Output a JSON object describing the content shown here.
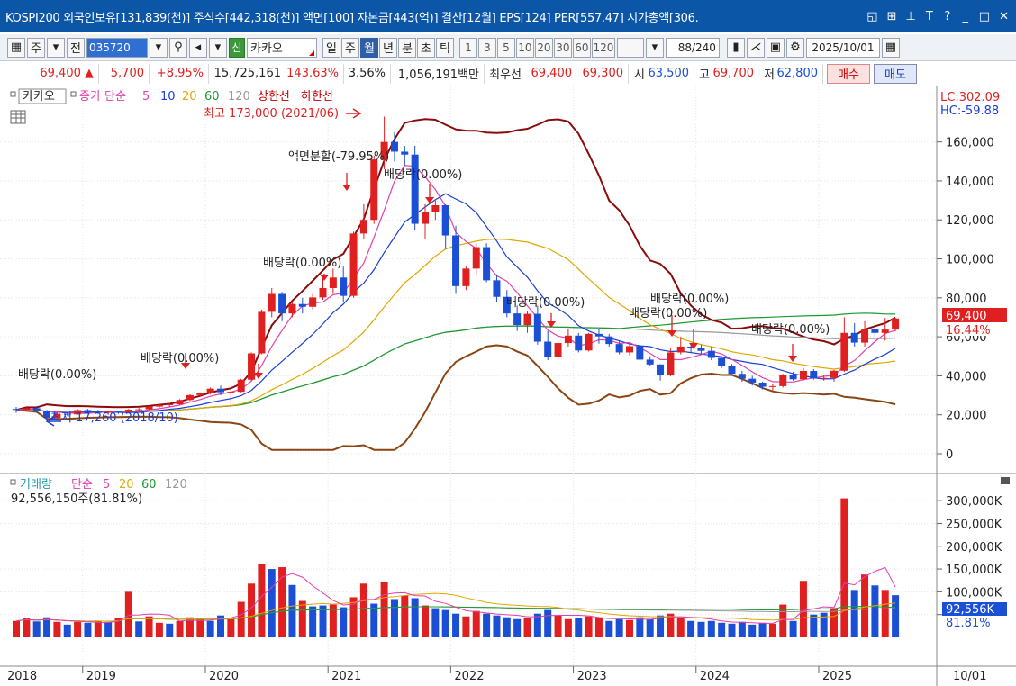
{
  "title_bar": {
    "text": "KOSPI200 외국인보유[131,839(천)] 주식수[442,318(천)] 액면[100] 자본금[443(억)] 결산[12월] EPS[124] PER[557.47] 시가총액[306."
  },
  "toolbar": {
    "kind_label": "주",
    "prev_label": "전",
    "code_value": "035720",
    "shin_label": "신",
    "stock_name": "카카오",
    "period_buttons": [
      "일",
      "주",
      "월",
      "년",
      "분",
      "초",
      "틱"
    ],
    "active_period": "월",
    "interval_buttons": [
      "1",
      "3",
      "5",
      "10",
      "20",
      "30",
      "60",
      "120"
    ],
    "count_text": "88/240",
    "date_value": "2025/10/01"
  },
  "price_bar": {
    "price": "69,400 ▲",
    "change": "5,700",
    "change_rate": "+8.95%",
    "volume": "15,725,161",
    "volume_rate": "143.63%",
    "turnover": "3.56%",
    "amount": "1,056,191백만",
    "best_label": "최우선",
    "best_ask": "69,400",
    "best_bid": "69,300",
    "open_label": "시",
    "open": "63,500",
    "high_label": "고",
    "high": "69,700",
    "low_label": "저",
    "low": "62,800",
    "buy_label": "매수",
    "sell_label": "매도"
  },
  "price_panel": {
    "stock_tag": "카카오",
    "legend_label": "종가 단순",
    "ma_labels": [
      "5",
      "10",
      "20",
      "60",
      "120"
    ],
    "ma_colors": [
      "#e040b0",
      "#1a3fd6",
      "#e0a800",
      "#1a9a30",
      "#999999"
    ],
    "band_labels": [
      "상한선",
      "하한선"
    ],
    "band_color": "#c00000",
    "lc_label": "LC:302.09",
    "hc_label": "HC:-59.88",
    "current_price_tag": "69,400",
    "current_rate_tag": "16.44%",
    "y_ticks": [
      "160,000",
      "140,000",
      "120,000",
      "100,000",
      "80,000",
      "60,000",
      "40,000",
      "20,000",
      "0"
    ],
    "annotations": [
      {
        "text": "최고 173,000 (2021/06)",
        "color": "#e02020"
      },
      {
        "text": "최저 17,260 (2018/10)",
        "color": "#1a3fd6"
      },
      {
        "text": "배당락(0.00%)",
        "color": "#222"
      },
      {
        "text": "배당락(0.00%)",
        "color": "#222"
      },
      {
        "text": "배당락(0.00%)",
        "color": "#222"
      },
      {
        "text": "액면분할(-79.95%)",
        "color": "#222"
      },
      {
        "text": "배당락(0.00%)",
        "color": "#222"
      },
      {
        "text": "배당락(0.00%)",
        "color": "#222"
      },
      {
        "text": "배당락(0.00%)",
        "color": "#222"
      },
      {
        "text": "배당락(0.00%)",
        "color": "#222"
      },
      {
        "text": "배당락(0.00%)",
        "color": "#222"
      }
    ]
  },
  "volume_panel": {
    "legend_label": "거래량",
    "legend_ma_label": "단순",
    "ma_labels": [
      "5",
      "20",
      "60",
      "120"
    ],
    "current_text": "92,556,150주(81.81%)",
    "volume_tag": "92,556K",
    "volume_rate_tag": "81.81%",
    "y_ticks": [
      "300,000K",
      "250,000K",
      "200,000K",
      "150,000K",
      "100,000K",
      "50,000K"
    ]
  },
  "x_axis": {
    "labels": [
      "2018",
      "2019",
      "2020",
      "2021",
      "2022",
      "2023",
      "2024",
      "2025"
    ],
    "right_label": "10/01"
  },
  "chart_data": {
    "type": "candlestick",
    "x_label": "",
    "y_label": "",
    "price_ylim": [
      0,
      175000
    ],
    "volume_ylim": [
      0,
      320000
    ],
    "months": 88,
    "start": "2018-06",
    "candles": [
      [
        23000,
        24000,
        21000,
        22500
      ],
      [
        22500,
        23800,
        21500,
        23400
      ],
      [
        23400,
        24500,
        22000,
        22000
      ],
      [
        22000,
        22500,
        17260,
        18500
      ],
      [
        18500,
        21000,
        18000,
        20500
      ],
      [
        20500,
        21500,
        19500,
        20200
      ],
      [
        20200,
        23000,
        20000,
        22400
      ],
      [
        22400,
        23000,
        21500,
        21800
      ],
      [
        21800,
        22500,
        20500,
        21000
      ],
      [
        21000,
        22000,
        20000,
        21600
      ],
      [
        21600,
        22000,
        20500,
        21200
      ],
      [
        21200,
        23000,
        21000,
        22600
      ],
      [
        22600,
        23500,
        22000,
        22800
      ],
      [
        22800,
        24500,
        22500,
        24200
      ],
      [
        24200,
        25500,
        23500,
        25000
      ],
      [
        25000,
        26000,
        24000,
        25400
      ],
      [
        25400,
        28000,
        25000,
        27600
      ],
      [
        27600,
        30500,
        27000,
        30100
      ],
      [
        30100,
        31500,
        29500,
        31000
      ],
      [
        31000,
        34000,
        30500,
        33400
      ],
      [
        33400,
        35000,
        30000,
        31600
      ],
      [
        31600,
        33000,
        24000,
        31800
      ],
      [
        31800,
        38500,
        31500,
        38000
      ],
      [
        38000,
        52000,
        37500,
        51500
      ],
      [
        51500,
        74000,
        51000,
        72800
      ],
      [
        72800,
        85000,
        70000,
        82000
      ],
      [
        82000,
        83000,
        68000,
        72000
      ],
      [
        72000,
        78000,
        70000,
        76800
      ],
      [
        76800,
        80000,
        72000,
        75400
      ],
      [
        75400,
        82000,
        74000,
        80200
      ],
      [
        80200,
        90000,
        79000,
        85000
      ],
      [
        85000,
        95000,
        82000,
        90400
      ],
      [
        90400,
        96000,
        78000,
        81000
      ],
      [
        81000,
        114000,
        80000,
        113000
      ],
      [
        113000,
        128000,
        110000,
        120000
      ],
      [
        120000,
        153000,
        118000,
        151000
      ],
      [
        151000,
        173000,
        146000,
        160000
      ],
      [
        160000,
        165000,
        150000,
        155000
      ],
      [
        155000,
        158000,
        148000,
        153500
      ],
      [
        153500,
        158000,
        115000,
        118000
      ],
      [
        118000,
        128000,
        110000,
        124000
      ],
      [
        124000,
        130000,
        120000,
        127500
      ],
      [
        127500,
        128000,
        105000,
        112000
      ],
      [
        112000,
        117000,
        82000,
        86000
      ],
      [
        86000,
        96000,
        84000,
        95000
      ],
      [
        95000,
        108000,
        92000,
        106000
      ],
      [
        106000,
        108000,
        88000,
        89000
      ],
      [
        89000,
        92000,
        78000,
        80500
      ],
      [
        80500,
        84000,
        70000,
        72000
      ],
      [
        72000,
        76000,
        63000,
        66000
      ],
      [
        66000,
        73000,
        62000,
        71800
      ],
      [
        71800,
        76000,
        56000,
        57500
      ],
      [
        57500,
        63000,
        48000,
        49800
      ],
      [
        49800,
        58000,
        48000,
        56800
      ],
      [
        56800,
        64000,
        55000,
        60600
      ],
      [
        60600,
        62000,
        52000,
        53000
      ],
      [
        53000,
        62000,
        52500,
        61500
      ],
      [
        61500,
        64000,
        56500,
        60200
      ],
      [
        60200,
        61500,
        55000,
        56300
      ],
      [
        56300,
        58000,
        51000,
        52000
      ],
      [
        52000,
        56000,
        50500,
        55200
      ],
      [
        55200,
        56000,
        48000,
        48300
      ],
      [
        48300,
        50000,
        45000,
        45800
      ],
      [
        45800,
        46000,
        37500,
        40200
      ],
      [
        40200,
        54000,
        39800,
        52000
      ],
      [
        52000,
        60000,
        51000,
        55000
      ],
      [
        55000,
        57000,
        52000,
        54300
      ],
      [
        54300,
        56000,
        51000,
        52800
      ],
      [
        52800,
        55000,
        48000,
        49200
      ],
      [
        49200,
        50000,
        44000,
        45000
      ],
      [
        45000,
        46000,
        40000,
        41000
      ],
      [
        41000,
        42500,
        37000,
        38500
      ],
      [
        38500,
        40000,
        35000,
        36500
      ],
      [
        36500,
        37000,
        33000,
        34400
      ],
      [
        34400,
        36000,
        32500,
        34700
      ],
      [
        34700,
        41000,
        34000,
        40200
      ],
      [
        40200,
        42000,
        37500,
        38200
      ],
      [
        38200,
        44000,
        37500,
        42500
      ],
      [
        42500,
        43500,
        38000,
        38800
      ],
      [
        38800,
        40500,
        37500,
        38900
      ],
      [
        38900,
        43000,
        37000,
        42600
      ],
      [
        42600,
        70000,
        42000,
        62000
      ],
      [
        62000,
        67000,
        55000,
        57000
      ],
      [
        57000,
        68000,
        55000,
        64000
      ],
      [
        64000,
        66000,
        60000,
        62000
      ],
      [
        62000,
        69700,
        58000,
        63700
      ],
      [
        63700,
        69700,
        62800,
        69400
      ]
    ],
    "volumes": [
      [
        36000,
        "up"
      ],
      [
        42000,
        "up"
      ],
      [
        35000,
        "dn"
      ],
      [
        44000,
        "dn"
      ],
      [
        34000,
        "up"
      ],
      [
        28000,
        "dn"
      ],
      [
        34000,
        "up"
      ],
      [
        32000,
        "dn"
      ],
      [
        36000,
        "up"
      ],
      [
        33000,
        "dn"
      ],
      [
        42000,
        "up"
      ],
      [
        100000,
        "up"
      ],
      [
        35000,
        "dn"
      ],
      [
        46000,
        "up"
      ],
      [
        32000,
        "up"
      ],
      [
        30000,
        "dn"
      ],
      [
        36000,
        "up"
      ],
      [
        44000,
        "up"
      ],
      [
        42000,
        "up"
      ],
      [
        36000,
        "dn"
      ],
      [
        48000,
        "dn"
      ],
      [
        42000,
        "up"
      ],
      [
        78000,
        "up"
      ],
      [
        118000,
        "up"
      ],
      [
        162000,
        "up"
      ],
      [
        150000,
        "dn"
      ],
      [
        154000,
        "up"
      ],
      [
        115000,
        "dn"
      ],
      [
        80000,
        "up"
      ],
      [
        68000,
        "dn"
      ],
      [
        70000,
        "dn"
      ],
      [
        72000,
        "up"
      ],
      [
        66000,
        "dn"
      ],
      [
        88000,
        "up"
      ],
      [
        118000,
        "up"
      ],
      [
        74000,
        "dn"
      ],
      [
        122000,
        "up"
      ],
      [
        84000,
        "dn"
      ],
      [
        92000,
        "up"
      ],
      [
        86000,
        "dn"
      ],
      [
        70000,
        "up"
      ],
      [
        64000,
        "dn"
      ],
      [
        60000,
        "dn"
      ],
      [
        52000,
        "dn"
      ],
      [
        46000,
        "up"
      ],
      [
        58000,
        "up"
      ],
      [
        52000,
        "dn"
      ],
      [
        48000,
        "dn"
      ],
      [
        44000,
        "dn"
      ],
      [
        40000,
        "dn"
      ],
      [
        42000,
        "up"
      ],
      [
        52000,
        "dn"
      ],
      [
        60000,
        "dn"
      ],
      [
        48000,
        "up"
      ],
      [
        40000,
        "up"
      ],
      [
        42000,
        "dn"
      ],
      [
        46000,
        "up"
      ],
      [
        42000,
        "up"
      ],
      [
        36000,
        "dn"
      ],
      [
        40000,
        "dn"
      ],
      [
        38000,
        "up"
      ],
      [
        44000,
        "dn"
      ],
      [
        40000,
        "dn"
      ],
      [
        48000,
        "dn"
      ],
      [
        52000,
        "up"
      ],
      [
        42000,
        "up"
      ],
      [
        36000,
        "dn"
      ],
      [
        34000,
        "dn"
      ],
      [
        36000,
        "dn"
      ],
      [
        32000,
        "dn"
      ],
      [
        30000,
        "dn"
      ],
      [
        34000,
        "dn"
      ],
      [
        28000,
        "dn"
      ],
      [
        32000,
        "dn"
      ],
      [
        30000,
        "up"
      ],
      [
        72000,
        "up"
      ],
      [
        36000,
        "dn"
      ],
      [
        124000,
        "up"
      ],
      [
        50000,
        "dn"
      ],
      [
        54000,
        "dn"
      ],
      [
        64000,
        "up"
      ],
      [
        305000,
        "up"
      ],
      [
        104000,
        "dn"
      ],
      [
        138000,
        "up"
      ],
      [
        114000,
        "dn"
      ],
      [
        104000,
        "up"
      ],
      [
        92556,
        "dn"
      ]
    ]
  }
}
